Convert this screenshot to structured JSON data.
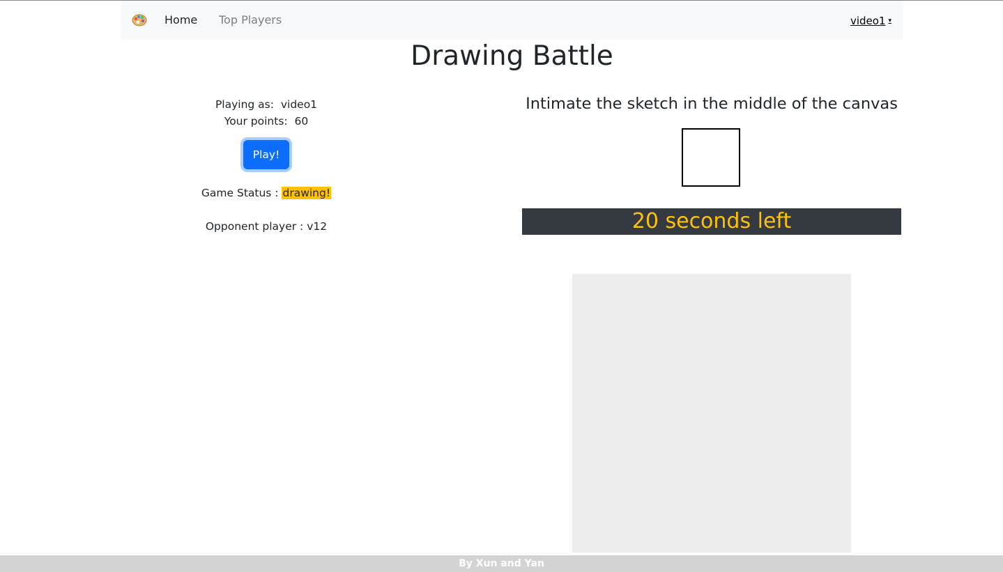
{
  "navbar": {
    "brand_icon": "palette-icon",
    "home_label": "Home",
    "top_players_label": "Top Players",
    "user_label": "video1",
    "user_caret": "▾"
  },
  "page": {
    "title": "Drawing Battle"
  },
  "player": {
    "playing_as_label": "Playing as:",
    "playing_as_value": "video1",
    "points_label": "Your points:",
    "points_value": "60",
    "play_button": "Play!",
    "status_label": "Game Status :",
    "status_value": "drawing!",
    "opponent_label": "Opponent player :",
    "opponent_value": "v12"
  },
  "game": {
    "instruction": "Intimate the sketch in the middle of the canvas",
    "timer_text": "20 seconds left"
  },
  "footer": {
    "text": "By Xun and Yan"
  },
  "colors": {
    "primary": "#0d6efd",
    "warning": "#ffc107",
    "dark": "#343a40",
    "canvas_bg": "#ededed",
    "footer_bg": "#d3d3d3"
  }
}
